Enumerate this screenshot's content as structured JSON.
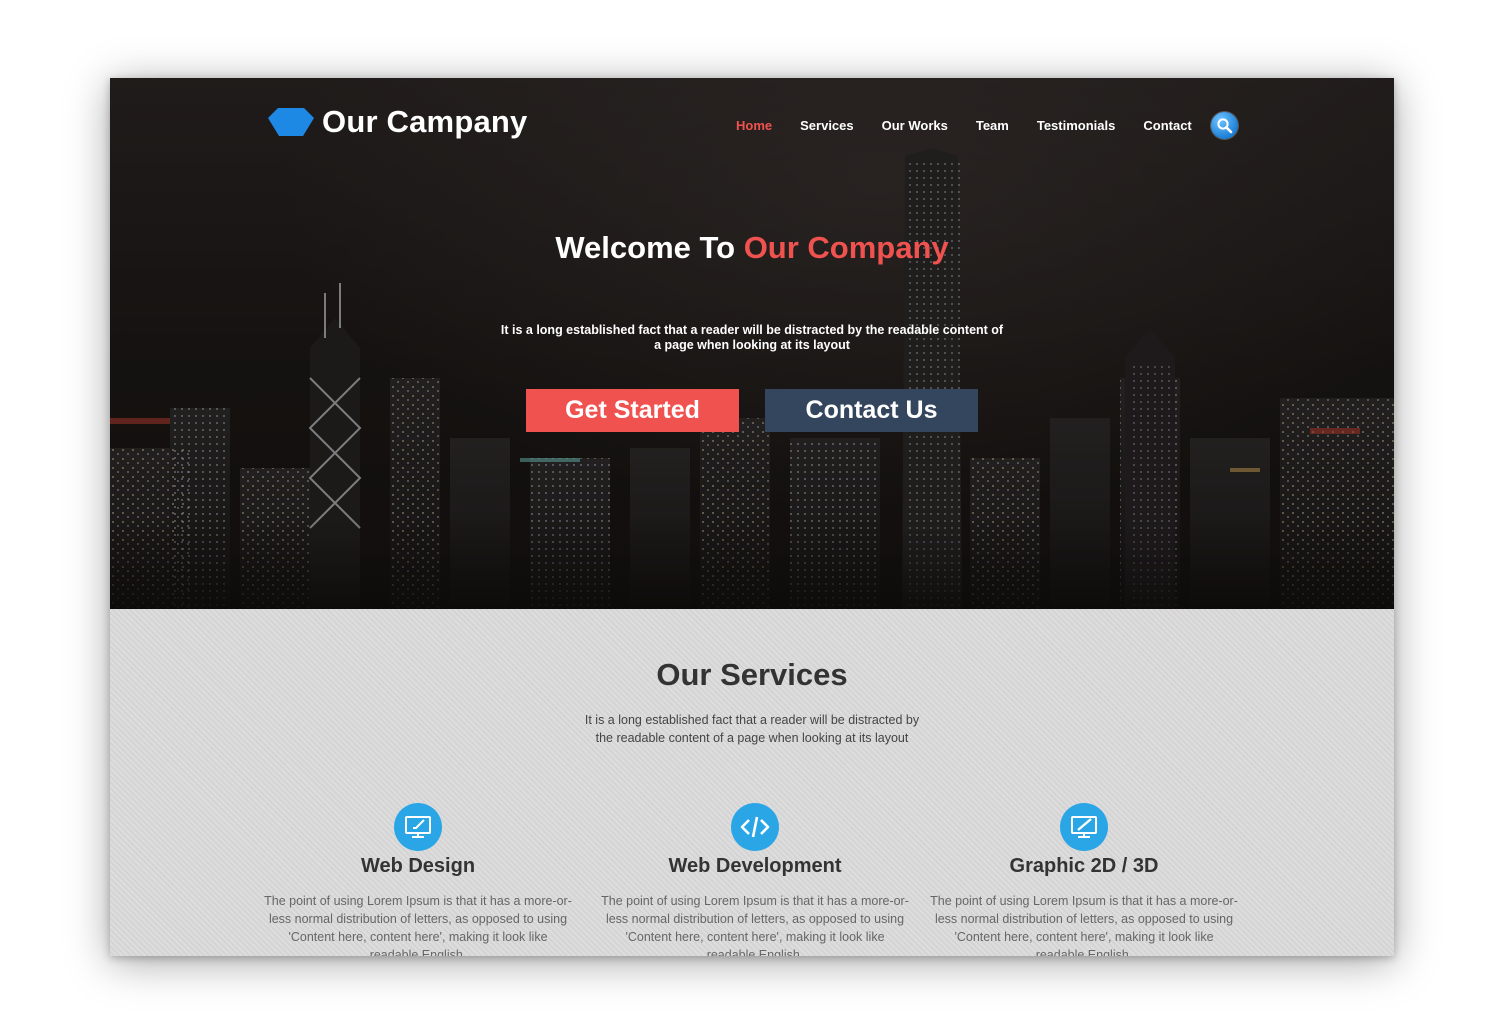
{
  "brand": {
    "name": "Our Campany",
    "logo_icon": "blue-pentagon-logo"
  },
  "nav": {
    "items": [
      {
        "label": "Home",
        "active": true
      },
      {
        "label": "Services",
        "active": false
      },
      {
        "label": "Our Works",
        "active": false
      },
      {
        "label": "Team",
        "active": false
      },
      {
        "label": "Testimonials",
        "active": false
      },
      {
        "label": "Contact",
        "active": false
      }
    ],
    "search_icon": "search-icon"
  },
  "hero": {
    "title_prefix": "Welcome To ",
    "title_accent": "Our Company",
    "subtitle": "It is a long established fact that a reader will be distracted by the readable content of a page when looking at its layout",
    "primary_button": "Get Started",
    "secondary_button": "Contact Us"
  },
  "services": {
    "title": "Our Services",
    "subtitle": "It is a long established fact that a reader will be distracted by the readable content of a page when looking at its layout",
    "cards": [
      {
        "icon": "monitor-edit-icon",
        "title": "Web Design",
        "text": "The point of using Lorem Ipsum is that it has a more-or-less normal distribution of letters, as opposed to using 'Content here, content here', making it look like readable English."
      },
      {
        "icon": "code-icon",
        "title": "Web Development",
        "text": "The point of using Lorem Ipsum is that it has a more-or-less normal distribution of letters, as opposed to using 'Content here, content here', making it look like readable English."
      },
      {
        "icon": "monitor-pen-icon",
        "title": "Graphic 2D / 3D",
        "text": "The point of using Lorem Ipsum is that it has a more-or-less normal distribution of letters, as opposed to using 'Content here, content here', making it look like readable English."
      }
    ]
  },
  "colors": {
    "accent": "#f0524f",
    "secondary": "#34465e",
    "icon_blue": "#2aa6e6",
    "logo_blue": "#1e88e5"
  }
}
